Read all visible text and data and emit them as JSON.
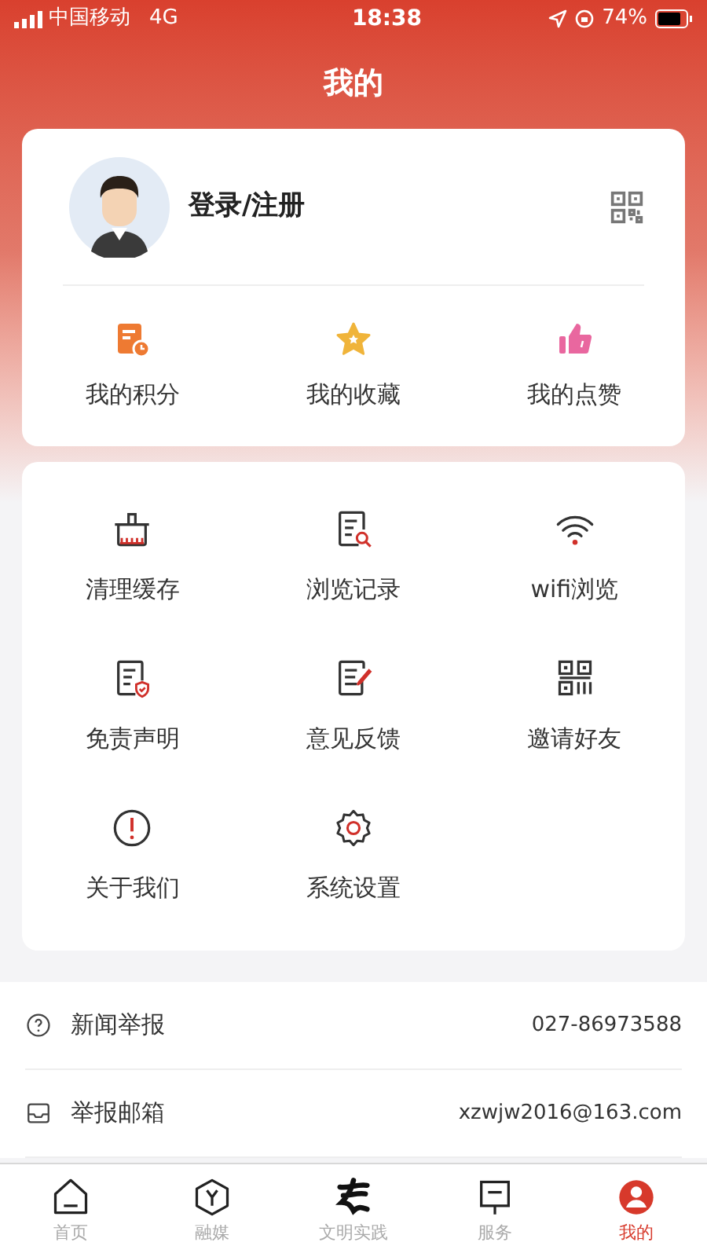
{
  "status_bar": {
    "carrier": "中国移动",
    "network": "4G",
    "time": "18:38",
    "battery": "74%"
  },
  "title": "我的",
  "profile": {
    "login": "登录/注册"
  },
  "quick": [
    {
      "label": "我的积分",
      "kind": "points"
    },
    {
      "label": "我的收藏",
      "kind": "star"
    },
    {
      "label": "我的点赞",
      "kind": "like"
    }
  ],
  "tools": [
    {
      "label": "清理缓存",
      "kind": "clean"
    },
    {
      "label": "浏览记录",
      "kind": "history"
    },
    {
      "label": "wifi浏览",
      "kind": "wifi"
    },
    {
      "label": "免责声明",
      "kind": "disclaimer"
    },
    {
      "label": "意见反馈",
      "kind": "feedback"
    },
    {
      "label": "邀请好友",
      "kind": "invite"
    },
    {
      "label": "关于我们",
      "kind": "about"
    },
    {
      "label": "系统设置",
      "kind": "settings"
    }
  ],
  "contacts": [
    {
      "label": "新闻举报",
      "value": "027-86973588",
      "kind": "phone"
    },
    {
      "label": "举报邮箱",
      "value": "xzwjw2016@163.com",
      "kind": "mail"
    }
  ],
  "tabs": [
    {
      "label": "首页",
      "kind": "home",
      "selected": false
    },
    {
      "label": "融媒",
      "kind": "media",
      "selected": false
    },
    {
      "label": "文明实践",
      "kind": "brush",
      "selected": false
    },
    {
      "label": "服务",
      "kind": "service",
      "selected": false
    },
    {
      "label": "我的",
      "kind": "me",
      "selected": true
    }
  ]
}
